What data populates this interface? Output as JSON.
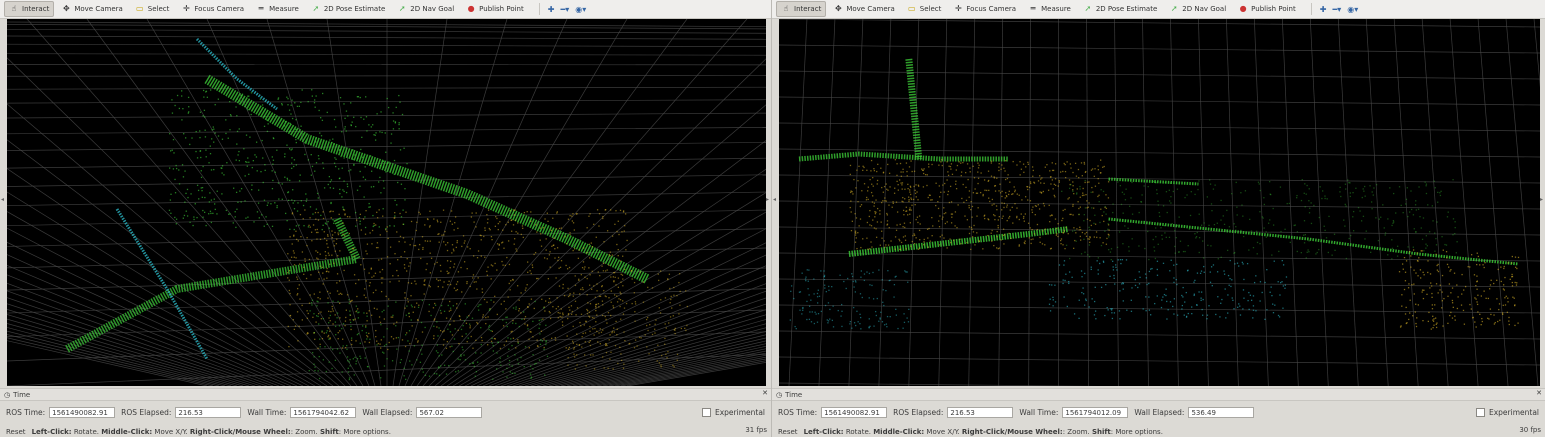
{
  "toolbar": {
    "tools": [
      {
        "label": "Interact",
        "icon": "interact-icon",
        "glyph": "☝"
      },
      {
        "label": "Move Camera",
        "icon": "move-camera-icon",
        "glyph": "✥"
      },
      {
        "label": "Select",
        "icon": "select-icon",
        "glyph": "▭"
      },
      {
        "label": "Focus Camera",
        "icon": "focus-camera-icon",
        "glyph": "✛"
      },
      {
        "label": "Measure",
        "icon": "measure-icon",
        "glyph": "═"
      },
      {
        "label": "2D Pose Estimate",
        "icon": "pose-estimate-icon",
        "glyph": "➚"
      },
      {
        "label": "2D Nav Goal",
        "icon": "nav-goal-icon",
        "glyph": "➚"
      },
      {
        "label": "Publish Point",
        "icon": "publish-point-icon",
        "glyph": "●"
      }
    ],
    "extra_icons": [
      "plus-icon",
      "minus-icon",
      "eye-icon"
    ]
  },
  "left": {
    "time_panel_title": "Time",
    "ros_time_label": "ROS Time:",
    "ros_time": "1561490082.91",
    "ros_elapsed_label": "ROS Elapsed:",
    "ros_elapsed": "216.53",
    "wall_time_label": "Wall Time:",
    "wall_time": "1561794042.62",
    "wall_elapsed_label": "Wall Elapsed:",
    "wall_elapsed": "567.02",
    "experimental_label": "Experimental",
    "reset_label": "Reset",
    "status_left_click": "Left-Click:",
    "status_rotate": " Rotate. ",
    "status_middle_click": "Middle-Click:",
    "status_move": " Move X/Y. ",
    "status_right_click": "Right-Click/Mouse Wheel:",
    "status_zoom": ": Zoom. ",
    "status_shift": "Shift",
    "status_more": ": More options.",
    "fps": "31 fps"
  },
  "right": {
    "time_panel_title": "Time",
    "ros_time_label": "ROS Time:",
    "ros_time": "1561490082.91",
    "ros_elapsed_label": "ROS Elapsed:",
    "ros_elapsed": "216.53",
    "wall_time_label": "Wall Time:",
    "wall_time": "1561794012.09",
    "wall_elapsed_label": "Wall Elapsed:",
    "wall_elapsed": "536.49",
    "experimental_label": "Experimental",
    "reset_label": "Reset",
    "status_left_click": "Left-Click:",
    "status_rotate": " Rotate. ",
    "status_middle_click": "Middle-Click:",
    "status_move": " Move X/Y. ",
    "status_right_click": "Right-Click/Mouse Wheel:",
    "status_zoom": ": Zoom. ",
    "status_shift": "Shift",
    "status_more": ": More options.",
    "fps": "30 fps"
  },
  "colors": {
    "viewport_bg": "#000000",
    "grid": "#4a4a4a",
    "cloud_green": "#3fd33a",
    "cloud_yellow": "#d9b326",
    "cloud_cyan": "#2bb6c4"
  }
}
